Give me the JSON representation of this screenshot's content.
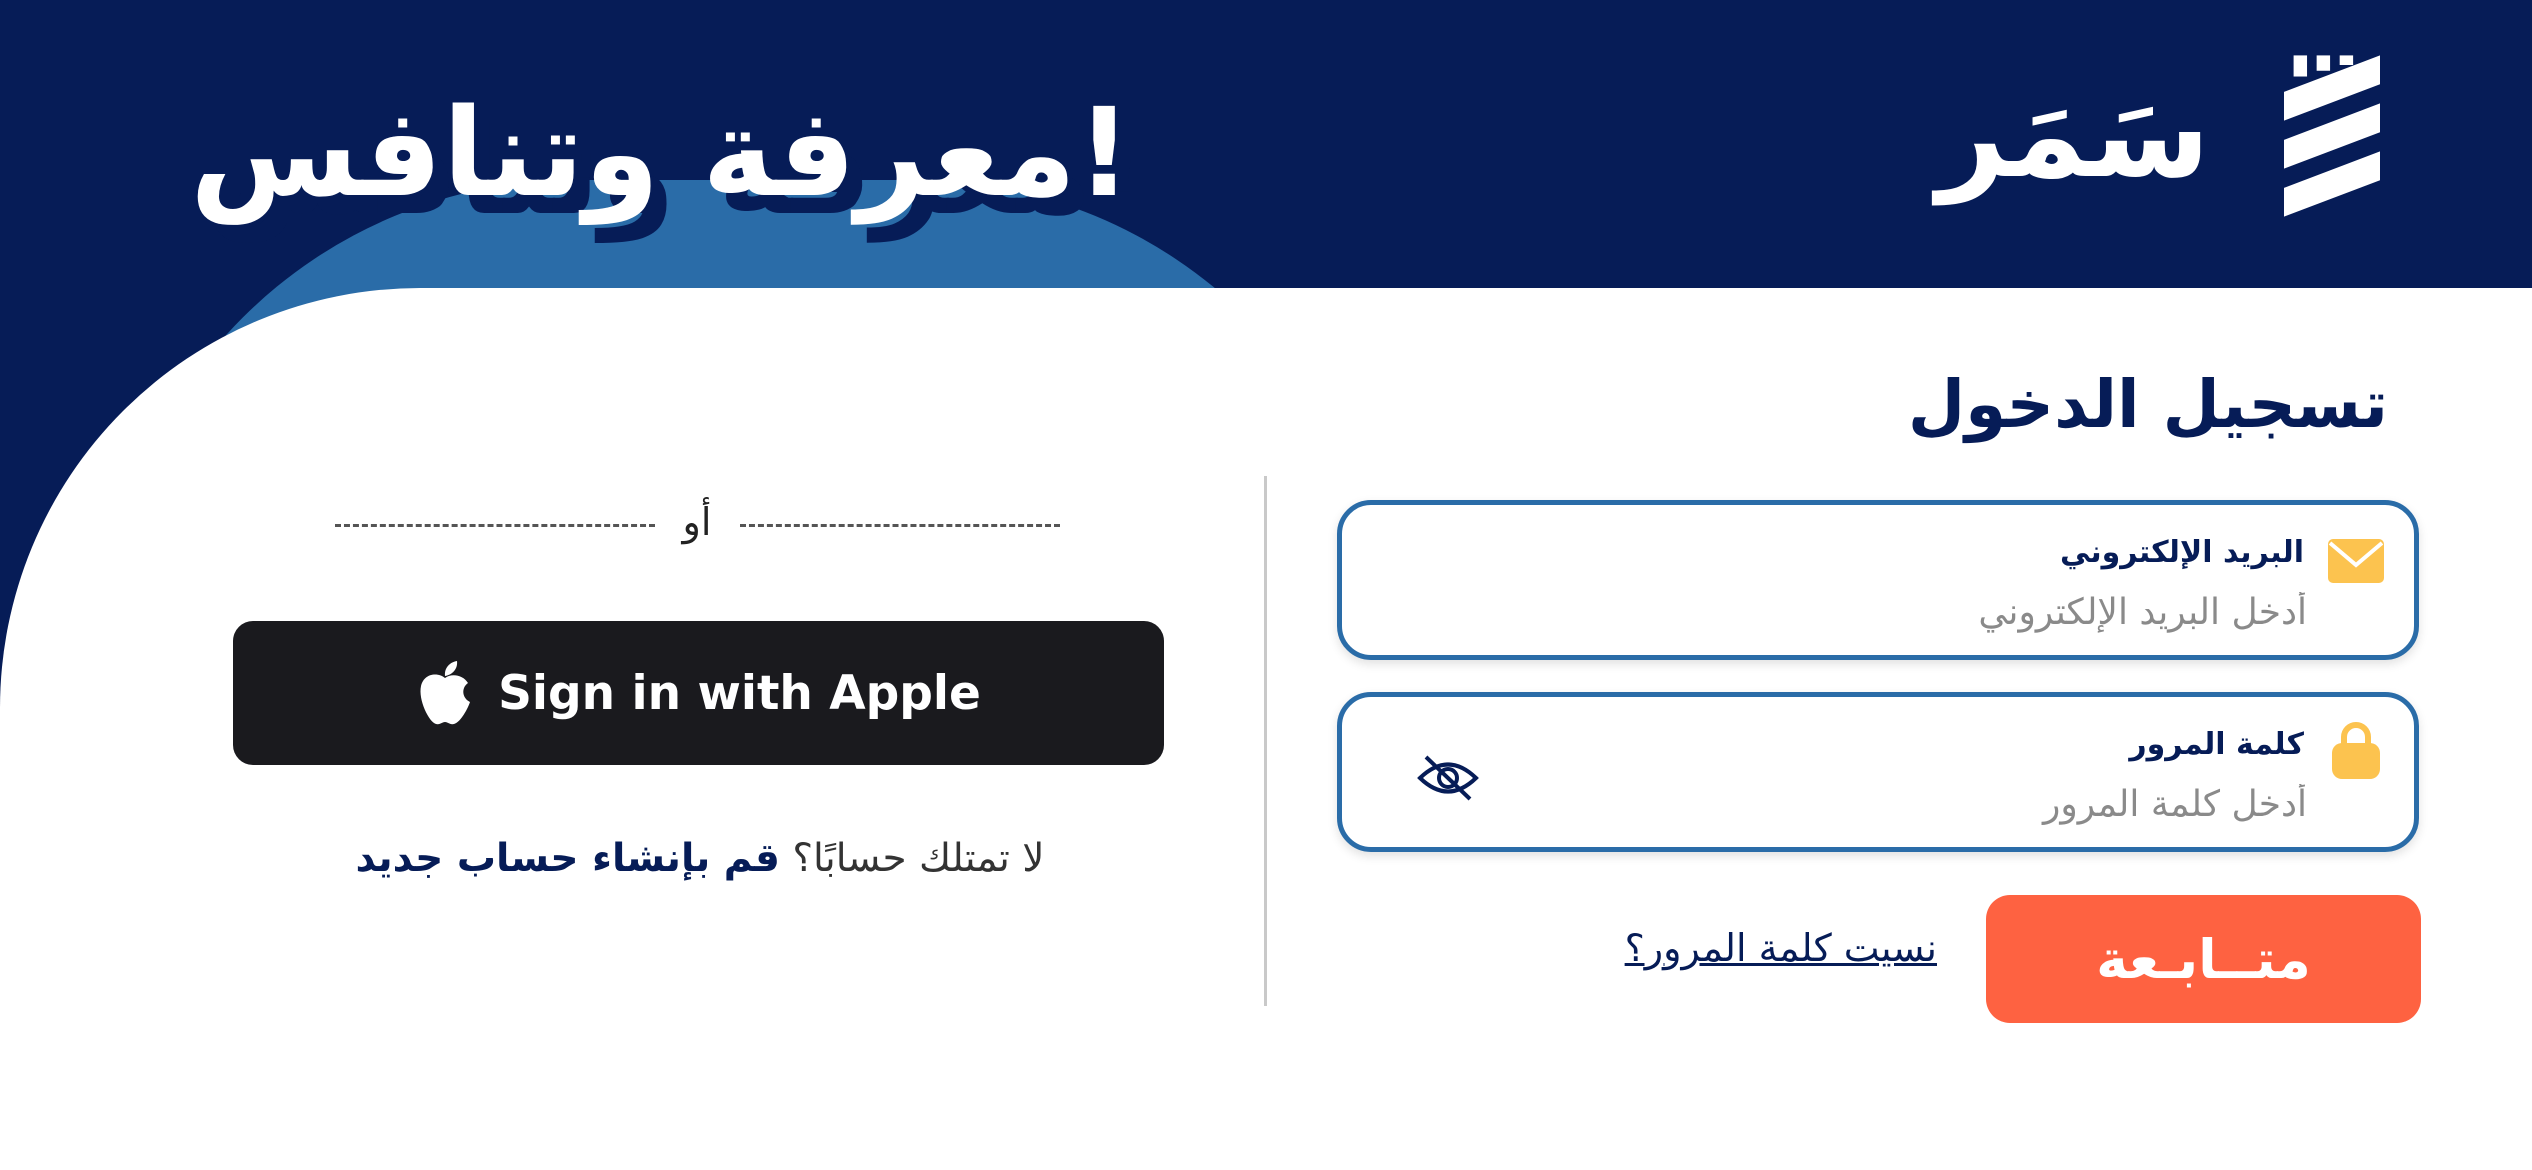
{
  "hero": {
    "tagline": "معرفة وتنافس!"
  },
  "logo": {
    "wordmark": "سَمَر",
    "icon": "stacked-bars-logo-icon"
  },
  "login": {
    "title": "تسجيل الدخول",
    "email": {
      "label": "البريد الإلكتروني",
      "placeholder": "أدخل البريد الإلكتروني",
      "value": "",
      "icon": "envelope-icon"
    },
    "password": {
      "label": "كلمة المرور",
      "placeholder": "أدخل كلمة المرور",
      "value": "",
      "icon": "lock-icon",
      "toggle_icon": "eye-slash-icon"
    },
    "continue_label": "متــابـعة",
    "forgot_label": "نسيت كلمة المرور؟"
  },
  "alt": {
    "or_label": "أو",
    "apple_label": "Sign in with Apple",
    "apple_icon": "apple-icon",
    "no_account_text": "لا تمتلك حسابًا؟",
    "create_account_label": "قم بإنشاء حساب جديد"
  },
  "colors": {
    "navy": "#061c57",
    "blue": "#2a6ca8",
    "accent": "#fe6241",
    "icon_yellow": "#fcc34f",
    "apple_button": "#1a1a1e"
  }
}
